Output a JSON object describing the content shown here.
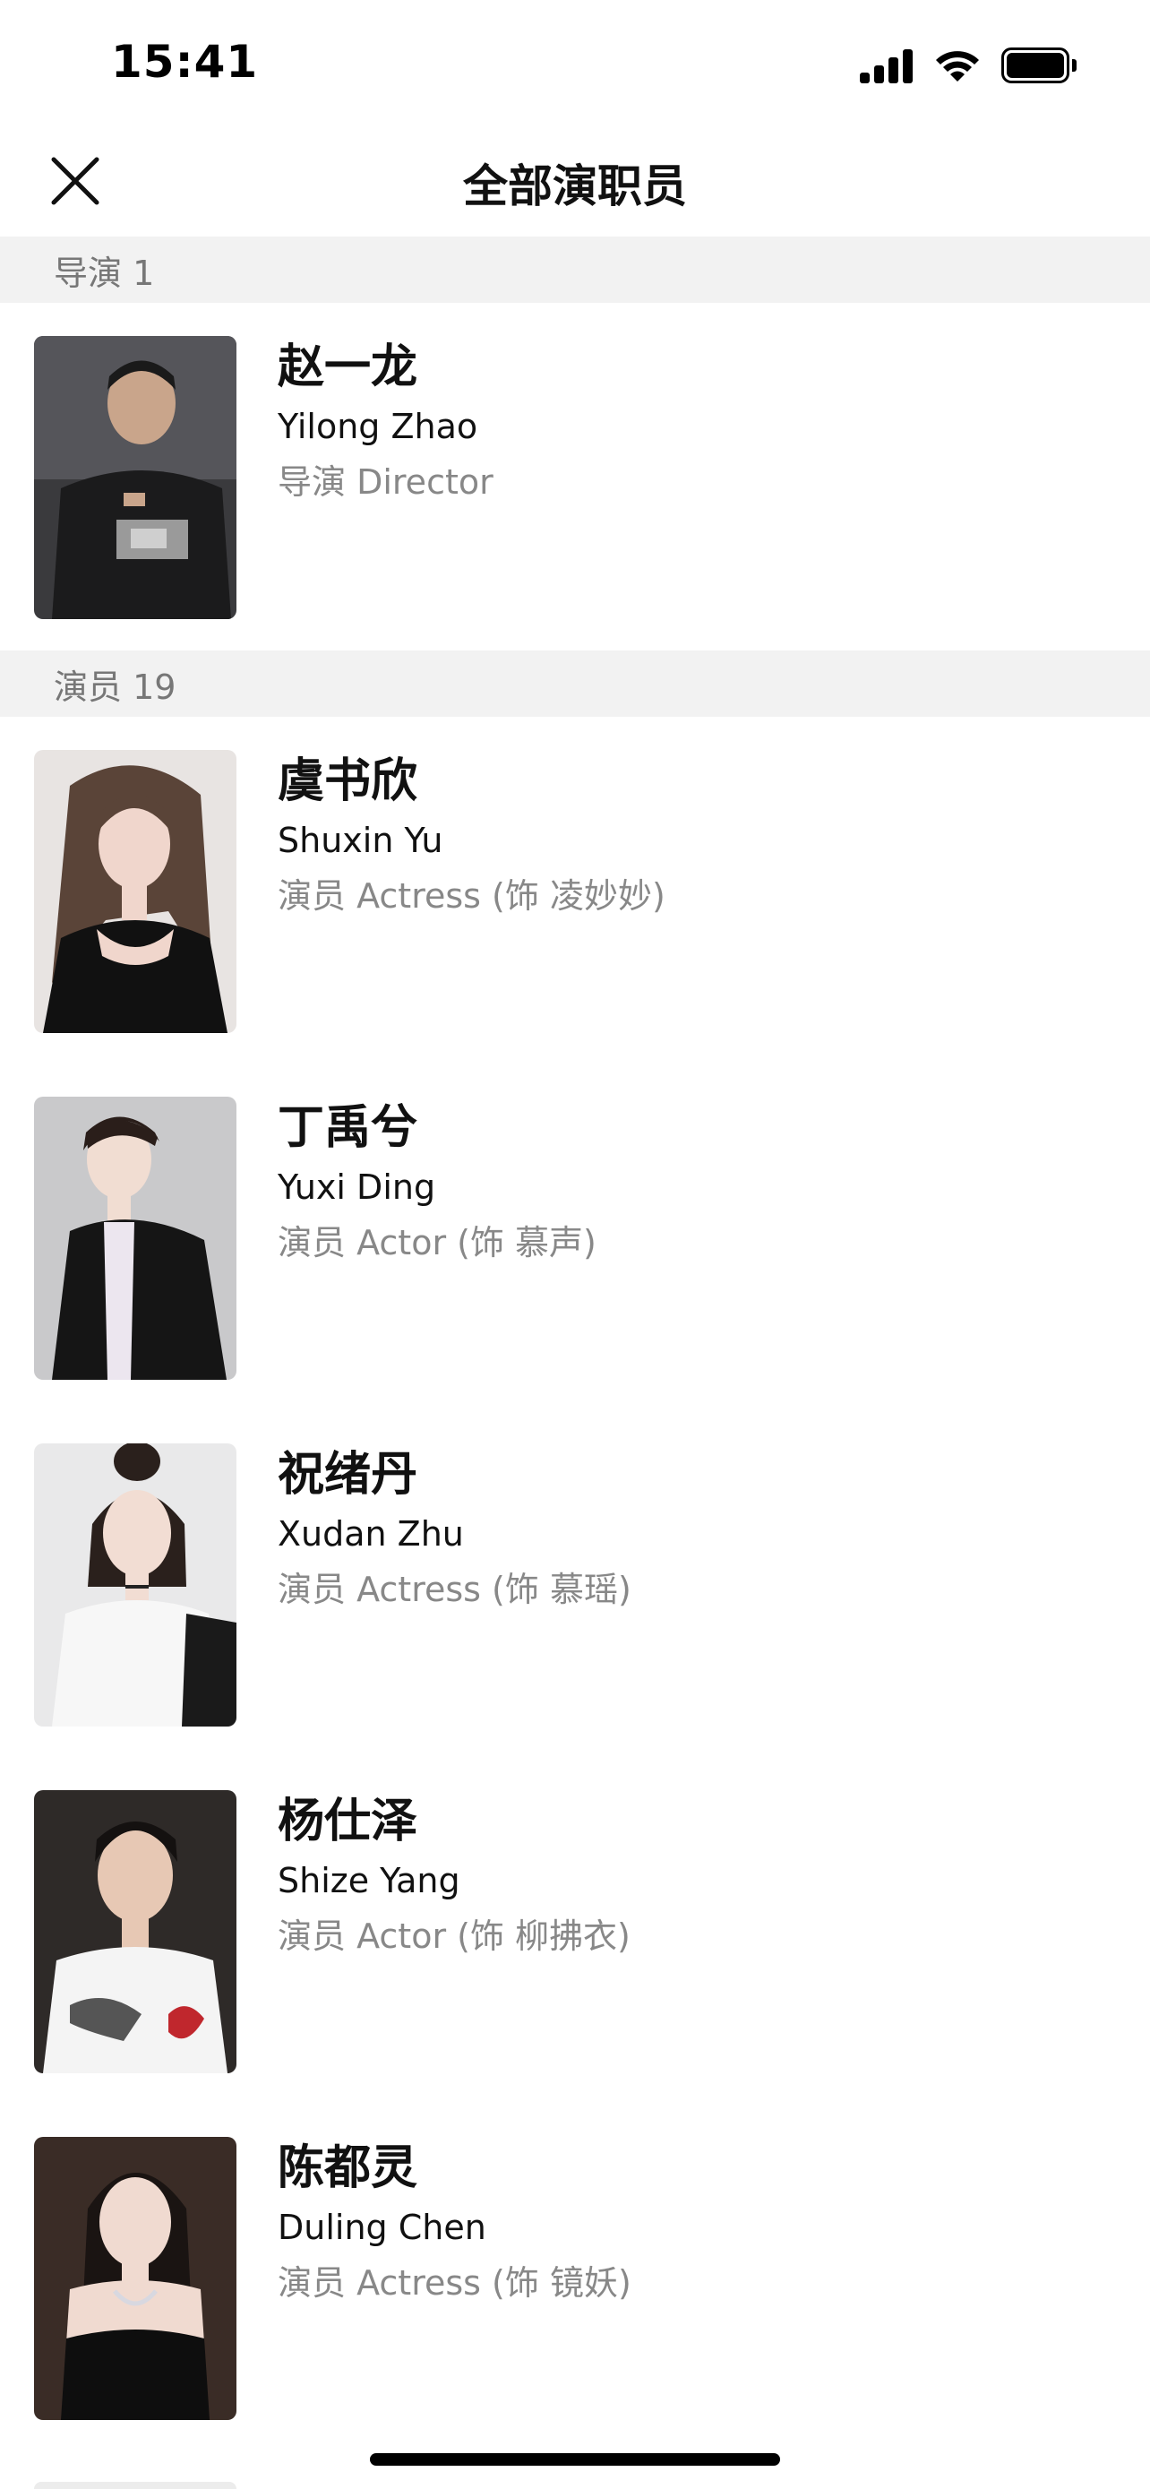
{
  "status": {
    "time": "15:41"
  },
  "nav": {
    "title": "全部演职员"
  },
  "sections": [
    {
      "header": "导演 1",
      "people": [
        {
          "name_cn": "赵一龙",
          "name_en": "Yilong Zhao",
          "role": "导演 Director"
        }
      ]
    },
    {
      "header": "演员 19",
      "people": [
        {
          "name_cn": "虞书欣",
          "name_en": "Shuxin Yu",
          "role": "演员 Actress (饰 凌妙妙)"
        },
        {
          "name_cn": "丁禹兮",
          "name_en": "Yuxi Ding",
          "role": "演员 Actor (饰 慕声)"
        },
        {
          "name_cn": "祝绪丹",
          "name_en": "Xudan Zhu",
          "role": "演员 Actress (饰 慕瑶)"
        },
        {
          "name_cn": "杨仕泽",
          "name_en": "Shize Yang",
          "role": "演员 Actor (饰 柳拂衣)"
        },
        {
          "name_cn": "陈都灵",
          "name_en": "Duling Chen",
          "role": "演员 Actress (饰 镜妖)"
        }
      ]
    }
  ]
}
